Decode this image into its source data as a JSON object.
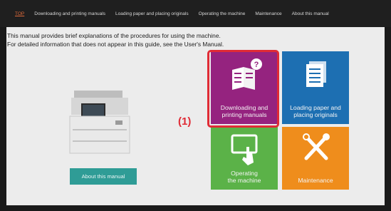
{
  "nav": {
    "items": [
      "TOP",
      "Downloading and printing manuals",
      "Loading paper and placing originals",
      "Operating the machine",
      "Maintenance",
      "About this manual"
    ]
  },
  "intro": {
    "line1": "This manual provides brief explanations of the procedures for using the machine.",
    "line2": "For detailed information that does not appear in this guide, see the User's Manual."
  },
  "about_button": "About this manual",
  "tiles": {
    "download": "Downloading and\nprinting manuals",
    "loading": "Loading paper and\nplacing originals",
    "operating": "Operating\nthe machine",
    "maintenance": "Maintenance"
  },
  "callout": "(1)",
  "colors": {
    "download": "#95237f",
    "loading": "#1d6fb2",
    "operating": "#5bb248",
    "maintenance": "#ef8d1c",
    "about": "#2f9c96",
    "highlight": "#e02b35"
  }
}
